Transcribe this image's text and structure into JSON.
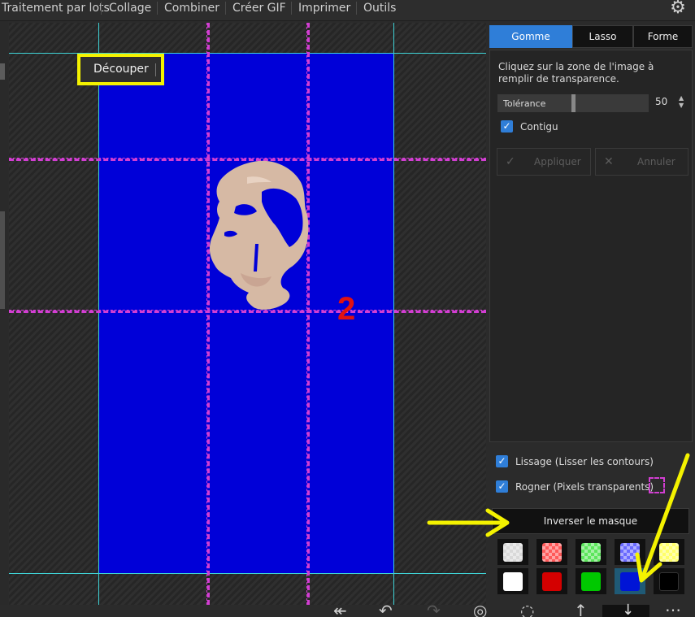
{
  "menu": {
    "items": [
      "Traitement par lots",
      "Collage",
      "Combiner",
      "Créer GIF",
      "Imprimer",
      "Outils"
    ],
    "settings_icon": "gear-icon"
  },
  "canvas": {
    "crop_label": "Découper",
    "annotation_number": "2",
    "image_bg_color": "#0000d8"
  },
  "panel": {
    "tabs": [
      "Gomme magique",
      "Lasso",
      "Forme"
    ],
    "active_tab": "Gomme magique",
    "description": "Cliquez sur la zone de l'image à remplir de transparence.",
    "tolerance_label": "Tolérance",
    "tolerance_value": "50",
    "contiguous_label": "Contigu",
    "contiguous_checked": true,
    "apply_label": "Appliquer",
    "cancel_label": "Annuler"
  },
  "options": {
    "smoothing_label": "Lissage (Lisser les contours)",
    "smoothing_checked": true,
    "trim_label": "Rogner (Pixels transparents)",
    "trim_checked": true,
    "invert_label": "Inverser le masque"
  },
  "swatches": {
    "transparent_row": [
      "#ffffff",
      "#ff5a5a",
      "#5ce65c",
      "#6a6aff",
      "#ffff6a"
    ],
    "solid_row": [
      "#ffffff",
      "#d40000",
      "#00c800",
      "#0014d6",
      "#000000"
    ],
    "selected": "#0014d6"
  },
  "colors": {
    "accent": "#2f7ed8",
    "highlight": "#f4f200",
    "guide_cyan": "#3fd3d6",
    "guide_magenta": "#d23ed2"
  }
}
